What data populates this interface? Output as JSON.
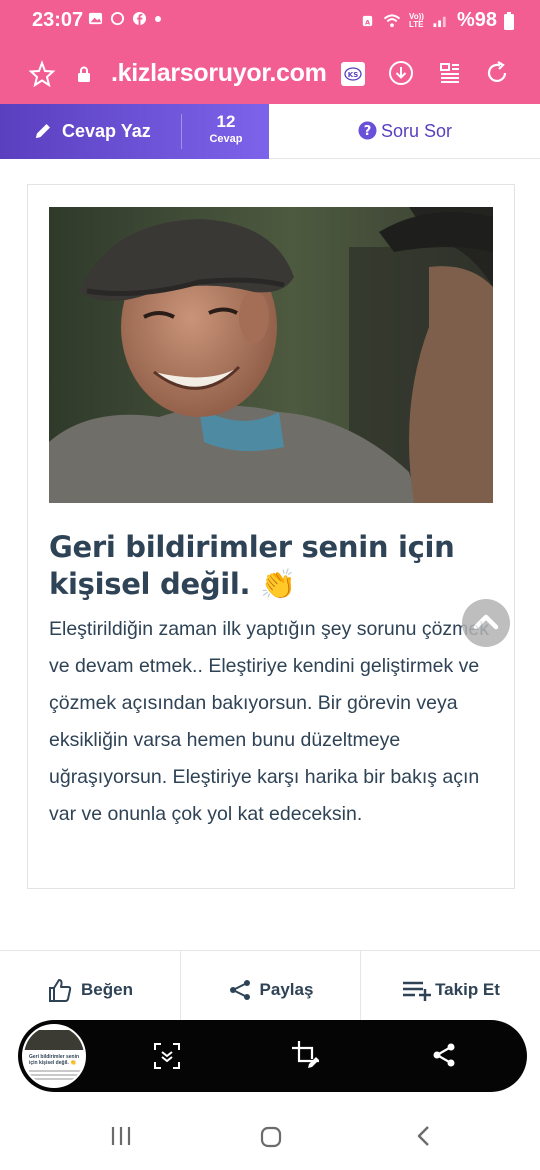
{
  "status_bar": {
    "time": "23:07",
    "battery": "%98",
    "icons": [
      "gallery-icon",
      "sync-icon",
      "facebook-icon",
      "dot-icon",
      "alarm-icon",
      "wifi-icon",
      "volte-icon",
      "signal-icon",
      "battery-icon"
    ],
    "volte_label": "Vo)) LTE"
  },
  "browser": {
    "url": ".kizlarsoruyor.com",
    "site_badge": "KS"
  },
  "action_bar": {
    "answer_label": "Cevap Yaz",
    "answer_count": "12",
    "answer_count_label": "Cevap",
    "ask_label": "Soru Sor",
    "accent_color": "#6a4fd8"
  },
  "card": {
    "title": "Geri bildirimler senin için kişisel değil. 👏",
    "body": "Eleştirildiğin zaman ilk yaptığın şey sorunu çözmek ve devam etmek.. Eleştiriye kendini geliştirmek ve çözmek açısından bakıyorsun. Bir görevin veya eksikliğin varsa hemen bunu düzeltmeye uğraşıyorsun. Eleştiriye karşı harika bir bakış açın var ve onunla çok yol kat edeceksin."
  },
  "bottom_actions": {
    "like_label": "Beğen",
    "share_label": "Paylaş",
    "follow_label": "Takip Et"
  },
  "screenshot_toolbar": {
    "thumb_caption": "Geri bildirimler senin için kişisel değil. 👏"
  },
  "colors": {
    "brand_pink": "#f25d92",
    "text_dark": "#2f4356"
  }
}
